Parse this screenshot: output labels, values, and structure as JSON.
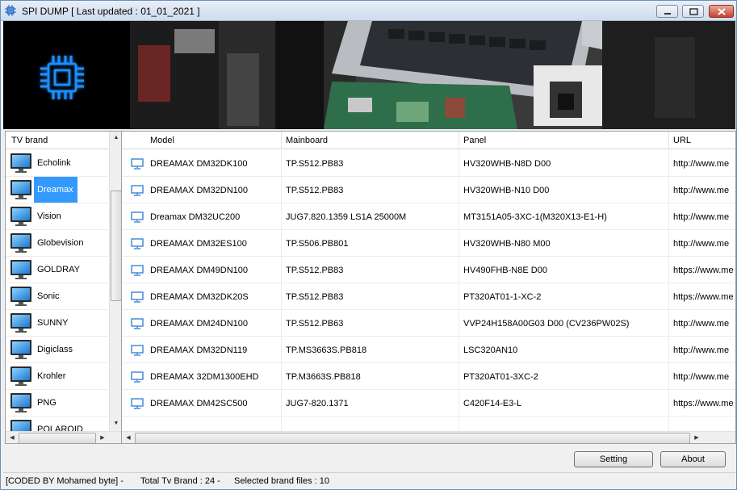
{
  "window": {
    "title": "SPI DUMP [ Last updated  : 01_01_2021 ]"
  },
  "brands": {
    "header": "TV brand",
    "items": [
      {
        "label": "Echolink"
      },
      {
        "label": "Dreamax",
        "selected": true
      },
      {
        "label": "Vision"
      },
      {
        "label": "Globevision"
      },
      {
        "label": "GOLDRAY"
      },
      {
        "label": "Sonic"
      },
      {
        "label": "SUNNY"
      },
      {
        "label": "Digiclass"
      },
      {
        "label": "Krohler"
      },
      {
        "label": "PNG"
      },
      {
        "label": "POLAROID"
      }
    ]
  },
  "table": {
    "columns": [
      "Model",
      "Mainboard",
      "Panel",
      "URL"
    ],
    "rows": [
      {
        "model": "DREAMAX DM32DK100",
        "mainboard": "TP.S512.PB83",
        "panel": "HV320WHB-N8D D00",
        "url": "http://www.me"
      },
      {
        "model": "DREAMAX DM32DN100",
        "mainboard": "TP.S512.PB83",
        "panel": "HV320WHB-N10 D00",
        "url": "http://www.me"
      },
      {
        "model": "Dreamax DM32UC200",
        "mainboard": "JUG7.820.1359 LS1A 25000M",
        "panel": "MT3151A05-3XC-1(M320X13-E1-H)",
        "url": "http://www.me"
      },
      {
        "model": "DREAMAX DM32ES100",
        "mainboard": "TP.S506.PB801",
        "panel": "HV320WHB-N80 M00",
        "url": "http://www.me"
      },
      {
        "model": "DREAMAX DM49DN100",
        "mainboard": "TP.S512.PB83",
        "panel": "HV490FHB-N8E D00",
        "url": "https://www.me"
      },
      {
        "model": "DREAMAX DM32DK20S",
        "mainboard": "TP.S512.PB83",
        "panel": "PT320AT01-1-XC-2",
        "url": "https://www.me"
      },
      {
        "model": "DREAMAX DM24DN100",
        "mainboard": "TP.S512.PB63",
        "panel": "VVP24H158A00G03 D00 (CV236PW02S)",
        "url": "http://www.me"
      },
      {
        "model": "DREAMAX DM32DN119",
        "mainboard": "TP.MS3663S.PB818",
        "panel": "LSC320AN10",
        "url": "http://www.me"
      },
      {
        "model": "DREAMAX 32DM1300EHD",
        "mainboard": "TP.M3663S.PB818",
        "panel": "PT320AT01-3XC-2",
        "url": "http://www.me"
      },
      {
        "model": "DREAMAX DM42SC500",
        "mainboard": "JUG7-820.1371",
        "panel": "C420F14-E3-L",
        "url": "https://www.me"
      }
    ]
  },
  "buttons": {
    "setting": "Setting",
    "about": "About"
  },
  "status": {
    "coded_by": "[CODED BY Mohamed byte] -",
    "total": "Total Tv Brand : 24 -",
    "selected": "Selected brand files : 10"
  },
  "icons": {
    "app": "chip-icon",
    "brand": "tv-icon",
    "model": "monitor-icon"
  },
  "colors": {
    "accent": "#3399ff",
    "chip_glow": "#1e90ff",
    "monitor_icon": "#2b7bd6"
  }
}
